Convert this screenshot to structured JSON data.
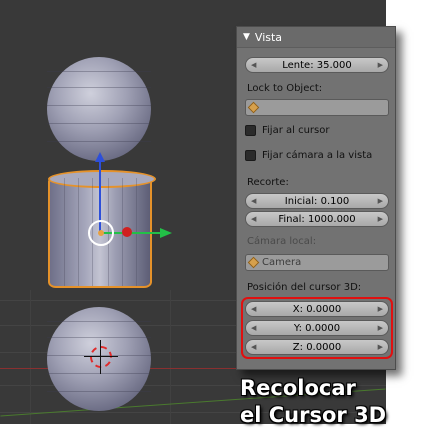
{
  "panel": {
    "title": "Vista",
    "lens": "Lente: 35.000",
    "lock_to_object_label": "Lock to Object:",
    "lock_to_object_value": "",
    "lock_cursor_label": "Fijar al cursor",
    "lock_camera_label": "Fijar cámara a la vista",
    "clip_label": "Recorte:",
    "clip_start": "Inicial: 0.100",
    "clip_end": "Final: 1000.000",
    "local_camera_label": "Cámara local:",
    "local_camera_value": "Camera",
    "cursor_label": "Posición del cursor 3D:",
    "cursor_x": "X: 0.0000",
    "cursor_y": "Y: 0.0000",
    "cursor_z": "Z: 0.0000"
  },
  "caption": {
    "line1": "Recolocar",
    "line2": "el Cursor 3D"
  },
  "colors": {
    "highlight_box": "#e01010",
    "selection_outline": "#e5922a",
    "axis_z": "#2d4fd9",
    "axis_y": "#22c047"
  },
  "icons": {
    "object": "cube-icon",
    "camera": "cube-icon",
    "panel_toggle": "triangle-down-icon"
  }
}
